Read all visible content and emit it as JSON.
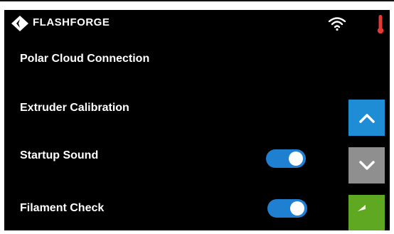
{
  "header": {
    "brand": "FLASHFORGE",
    "icons": [
      "flashforge-logo-icon",
      "wifi-icon",
      "thermometer-icon"
    ]
  },
  "settings": [
    {
      "label": "Polar Cloud Connection"
    },
    {
      "label": "Extruder Calibration"
    },
    {
      "label": "Startup Sound",
      "toggle": "on"
    },
    {
      "label": "Filament Check",
      "toggle": "on"
    }
  ],
  "buttons": {
    "up_icon": "chevron-up-icon",
    "down_icon": "chevron-down-icon",
    "back_icon": "back-arrow-icon"
  },
  "colors": {
    "background": "#000000",
    "toggle_on": "#1f7fd1",
    "up_button": "#1f8dd6",
    "down_button": "#8f8f8f",
    "back_button": "#5fa822",
    "thermometer": "#e53935"
  }
}
